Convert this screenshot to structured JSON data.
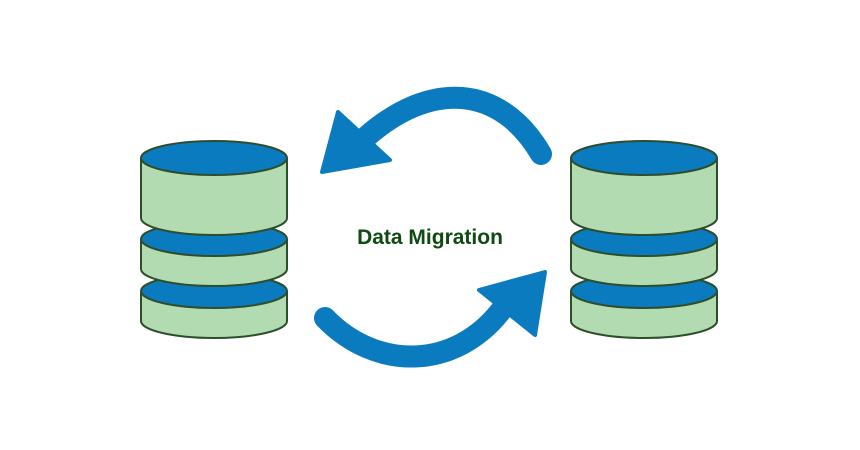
{
  "diagram": {
    "title": "Data Migration"
  },
  "colors": {
    "background": "#ffffff",
    "database_band": "#0b7bc0",
    "database_body": "#b3dbb1",
    "database_outline": "#2d4e2a",
    "arrow": "#0b7bc0",
    "title_text": "#0f4a12"
  },
  "icons": {
    "left_database": "database-icon",
    "right_database": "database-icon",
    "top_arrow": "curved-arrow-left-icon",
    "bottom_arrow": "curved-arrow-right-icon"
  }
}
